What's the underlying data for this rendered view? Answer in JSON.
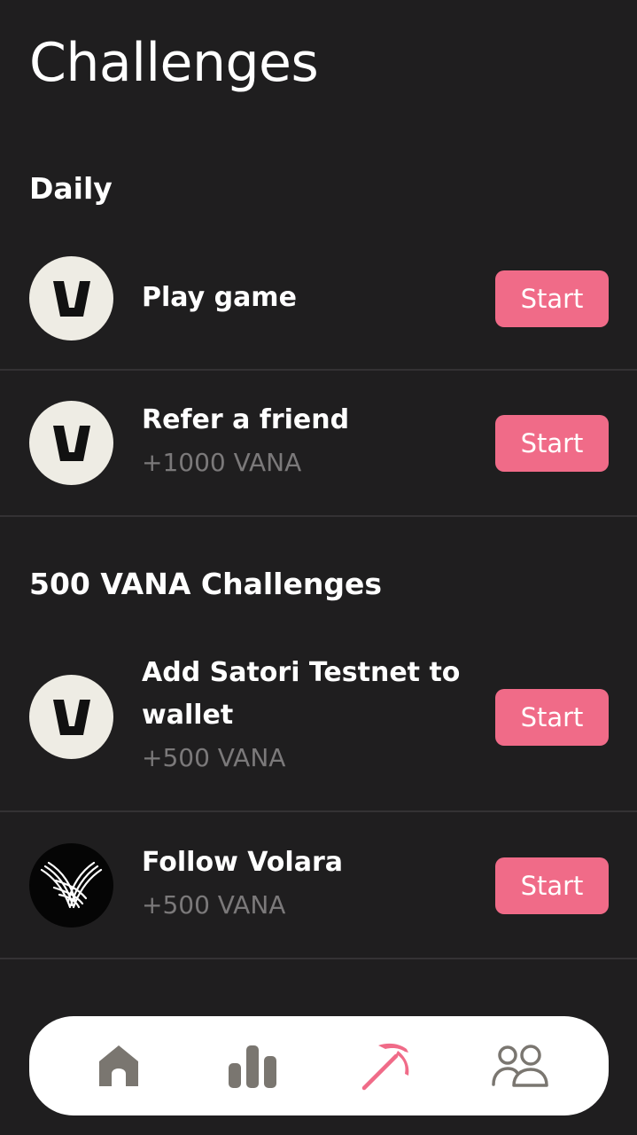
{
  "header": {
    "title": "Challenges"
  },
  "sections": {
    "daily": {
      "title": "Daily",
      "items": [
        {
          "title": "Play game",
          "subtitle": "",
          "icon": "vana-logo-icon",
          "button": "Start"
        },
        {
          "title": "Refer a friend",
          "subtitle": "+1000 VANA",
          "icon": "vana-logo-icon",
          "button": "Start"
        }
      ]
    },
    "vana500": {
      "title": "500 VANA Challenges",
      "items": [
        {
          "title_line1": "Add Satori Testnet to",
          "title_line2": "wallet",
          "subtitle": "+500 VANA",
          "icon": "vana-logo-icon",
          "button": "Start"
        },
        {
          "title": "Follow Volara",
          "subtitle": "+500 VANA",
          "icon": "volara-logo-icon",
          "button": "Start"
        }
      ]
    }
  },
  "bottom_nav": {
    "items": [
      {
        "icon": "home-icon",
        "active": false
      },
      {
        "icon": "bar-chart-icon",
        "active": false
      },
      {
        "icon": "pickaxe-icon",
        "active": true
      },
      {
        "icon": "users-icon",
        "active": false
      }
    ]
  },
  "colors": {
    "background": "#1f1e1f",
    "accent": "#f06b88",
    "muted_text": "#7b797a",
    "nav_icon": "#7a7670"
  }
}
